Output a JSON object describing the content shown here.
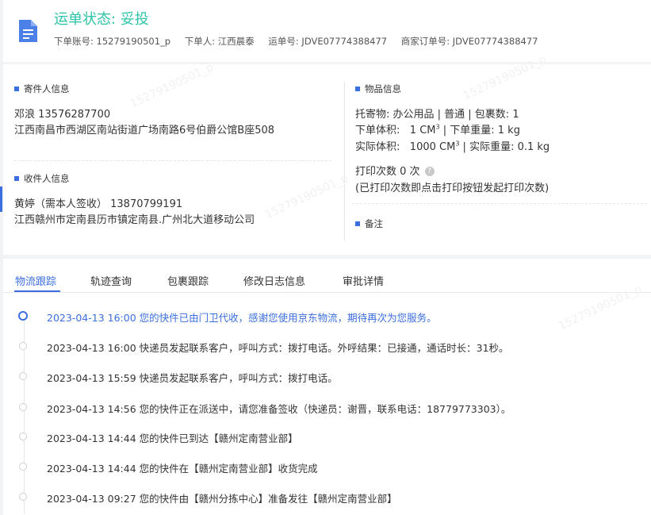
{
  "header": {
    "status_label": "运单状态: 妥投",
    "order_account": "下单账号: 15279190501_p",
    "orderer": "下单人: 江西晨泰",
    "waybill": "运单号: JDVE07774388477",
    "merchant_order": "商家订单号: JDVE07774388477"
  },
  "sender": {
    "section_title": "寄件人信息",
    "name_phone": "邓浪   13576287700",
    "address": "江西南昌市西湖区南站街道广场南路6号伯爵公馆B座508"
  },
  "receiver": {
    "section_title": "收件人信息",
    "name_phone": "黄婷（需本人签收）   13870799191",
    "address": "江西赣州市定南县历市镇定南县.广州北大道移动公司"
  },
  "goods": {
    "section_title": "物品信息",
    "line1": "托寄物:  办公用品 | 普通  |  包裹数:  1",
    "order_volume_label": "下单体积:",
    "order_volume_value": "1 CM",
    "order_weight": "下单重量:   1 kg",
    "actual_volume_label": "实际体积:",
    "actual_volume_value": "1000 CM",
    "actual_weight": "实际重量:   0.1 kg",
    "volume_exp": "3",
    "separator": "|",
    "print_count": "打印次数    0 次",
    "print_note": "(已打印次数即点击打印按钮发起打印次数)",
    "remark_title": "备注"
  },
  "tabs": [
    "物流跟踪",
    "轨迹查询",
    "包裹跟踪",
    "修改日志信息",
    "审批详情"
  ],
  "timeline": [
    {
      "time": "2023-04-13 16:00",
      "text": "您的快件已由门卫代收，感谢您使用京东物流，期待再次为您服务。"
    },
    {
      "time": "2023-04-13 16:00",
      "text": "快递员发起联系客户，呼叫方式：拨打电话。外呼结果：已接通，通话时长：31秒。"
    },
    {
      "time": "2023-04-13 15:59",
      "text": "快递员发起联系客户，呼叫方式：拨打电话。"
    },
    {
      "time": "2023-04-13 14:56",
      "text": "您的快件正在派送中，请您准备签收（快递员：谢晋，联系电话：18779773303）。"
    },
    {
      "time": "2023-04-13 14:44",
      "text": "您的快件已到达【赣州定南营业部】"
    },
    {
      "time": "2023-04-13 14:44",
      "text": "您的快件在【赣州定南营业部】收货完成"
    },
    {
      "time": "2023-04-13 09:27",
      "text": "您的快件由【赣州分拣中心】准备发往【赣州定南营业部】"
    }
  ],
  "watermark": "15279190501_p",
  "colors": {
    "accent": "#3b6ede",
    "status": "#2ec4a8"
  }
}
